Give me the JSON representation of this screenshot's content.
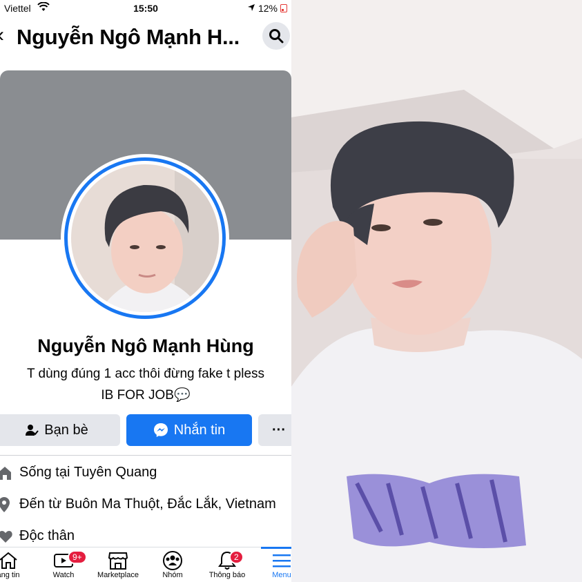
{
  "status_bar": {
    "carrier": "Viettel",
    "time": "15:50",
    "battery": "12%"
  },
  "header": {
    "title": "Nguyễn Ngô Mạnh H..."
  },
  "profile": {
    "name": "Nguyễn Ngô Mạnh Hùng",
    "bio_line1": "T dùng đúng 1 acc thôi đừng fake t pless",
    "bio_line2": "IB FOR JOB💬"
  },
  "actions": {
    "friends_label": "Bạn bè",
    "message_label": "Nhắn tin",
    "more_label": "···"
  },
  "details": {
    "lives_prefix": "Sống tại",
    "lives_value": "Tuyên Quang",
    "from_prefix": "Đến từ",
    "from_value": "Buôn Ma Thuột, Đắc Lắk, Vietnam",
    "relationship": "Độc thân"
  },
  "tabs": [
    {
      "label": "ảng tin",
      "icon": "home-icon"
    },
    {
      "label": "Watch",
      "icon": "watch-icon",
      "badge": "9+"
    },
    {
      "label": "Marketplace",
      "icon": "marketplace-icon"
    },
    {
      "label": "Nhóm",
      "icon": "groups-icon"
    },
    {
      "label": "Thông báo",
      "icon": "bell-icon",
      "badge": "2"
    },
    {
      "label": "Menu",
      "icon": "menu-icon"
    }
  ],
  "colors": {
    "accent": "#1877f2",
    "badge": "#e41e3f",
    "cover": "#8a8d91"
  }
}
